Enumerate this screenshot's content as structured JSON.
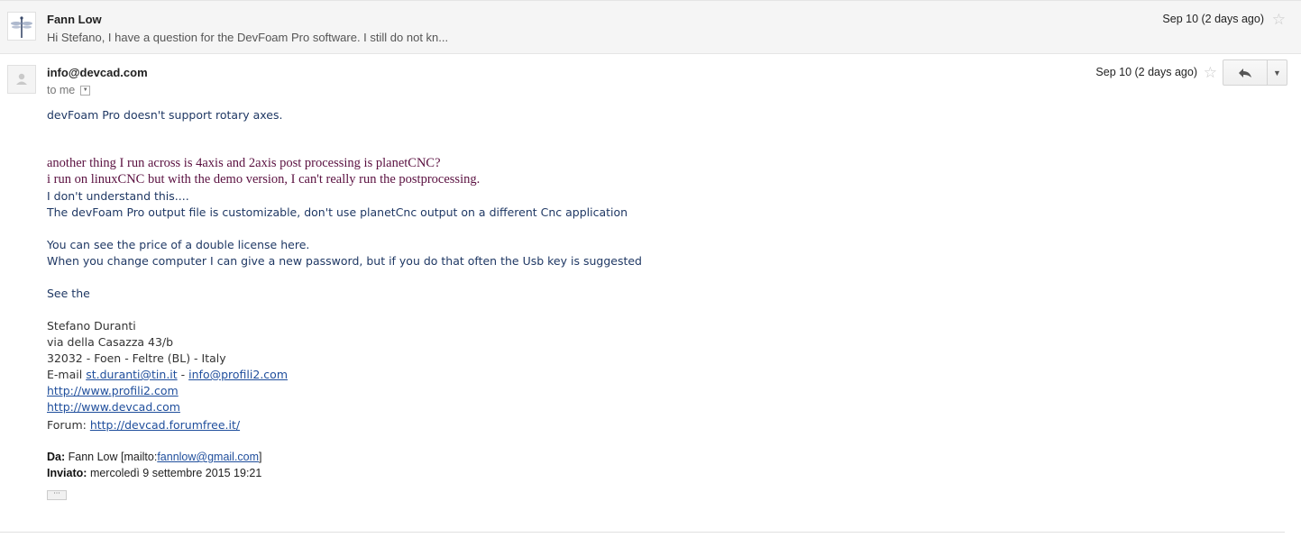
{
  "thread": [
    {
      "sender": "Fann Low",
      "snippet": "Hi Stefano, I have a question for the DevFoam Pro software. I still do not kn...",
      "date": "Sep 10 (2 days ago)",
      "avatar_icon": "dragonfly-icon"
    },
    {
      "sender": "info@devcad.com",
      "to_label": "to me",
      "date": "Sep 10 (2 days ago)",
      "avatar_icon": "person-icon",
      "body": {
        "line1": "devFoam Pro doesn't support rotary axes.",
        "quote1": "another thing I run across is 4axis and 2axis post processing is planetCNC?",
        "quote2": "i run on linuxCNC but with the demo version, I can't really run the postprocessing.",
        "line2": "I don't understand this....",
        "line3": "The devFoam Pro output file is customizable, don't use planetCnc output on a different Cnc application",
        "line4": "You can see the price of a double license here.",
        "line5": "When you change computer I can give a new password, but if you do that often the Usb key is suggested",
        "line6": "See the",
        "sig_name": "Stefano Duranti",
        "sig_address": "via della Casazza 43/b",
        "sig_city": "32032 - Foen - Feltre (BL) - Italy",
        "sig_email_label": "E-mail",
        "sig_email1": "st.duranti@tin.it",
        "sig_email_sep": "-",
        "sig_email2": "info@profili2.com",
        "sig_url1": "http://www.profili2.com",
        "sig_url2": "http://www.devcad.com",
        "sig_forum_label": "Forum:",
        "sig_forum_url": "http://devcad.forumfree.it/",
        "from_label": "Da:",
        "from_value": "Fann Low [mailto:",
        "from_email": "fannlow@gmail.com",
        "from_close": "]",
        "sent_label": "Inviato:",
        "sent_value": "mercoledì 9 settembre 2015 19:21",
        "ellipsis": "···"
      }
    }
  ],
  "icons": {
    "star": "star-outline-icon",
    "reply": "reply-icon",
    "more": "dropdown-caret-icon"
  }
}
